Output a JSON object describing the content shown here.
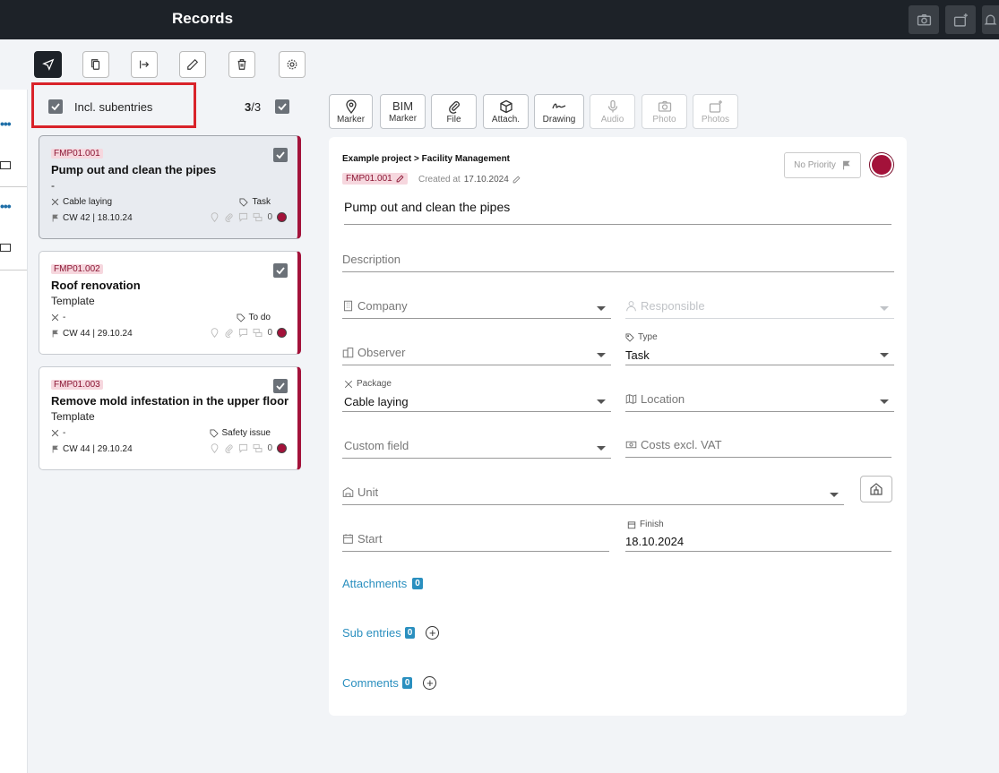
{
  "header": {
    "title": "Records"
  },
  "toolbar": {
    "buttons": [
      "send-icon",
      "copy-icon",
      "move-icon",
      "edit-icon",
      "delete-icon",
      "settings-icon"
    ]
  },
  "list": {
    "incl_subentries_label": "Incl. subentries",
    "count_selected": "3",
    "count_total": "/3",
    "cards": [
      {
        "code": "FMP01.001",
        "title": "Pump out and clean the pipes",
        "subtitle": "-",
        "package": "Cable laying",
        "type": "Task",
        "date": "CW 42 | 18.10.24",
        "comments": "0"
      },
      {
        "code": "FMP01.002",
        "title": "Roof renovation",
        "subtitle": "Template",
        "package": "-",
        "type": "To do",
        "date": "CW 44 | 29.10.24",
        "comments": "0"
      },
      {
        "code": "FMP01.003",
        "title": "Remove mold infestation in the upper floor",
        "subtitle": "Template",
        "package": "-",
        "type": "Safety issue",
        "date": "CW 44 | 29.10.24",
        "comments": "0"
      }
    ]
  },
  "media_toolbar": {
    "marker": "Marker",
    "bim_top": "BIM",
    "bim_bottom": "Marker",
    "file": "File",
    "attach": "Attach.",
    "drawing": "Drawing",
    "audio": "Audio",
    "photo": "Photo",
    "photos": "Photos"
  },
  "detail": {
    "breadcrumb": "Example project > Facility Management",
    "code": "FMP01.001",
    "created_label": "Created at",
    "created_date": "17.10.2024",
    "priority": "No Priority",
    "title": "Pump out and clean the pipes",
    "description_placeholder": "Description",
    "company_placeholder": "Company",
    "responsible_placeholder": "Responsible",
    "observer_placeholder": "Observer",
    "type_label": "Type",
    "type_value": "Task",
    "package_label": "Package",
    "package_value": "Cable laying",
    "location_placeholder": "Location",
    "custom_field_placeholder": "Custom field",
    "costs_placeholder": "Costs excl. VAT",
    "unit_placeholder": "Unit",
    "start_placeholder": "Start",
    "finish_label": "Finish",
    "finish_value": "18.10.2024",
    "attachments_label": "Attachments",
    "attachments_count": "0",
    "subentries_label": "Sub entries",
    "subentries_count": "0",
    "comments_label": "Comments",
    "comments_count": "0"
  },
  "colors": {
    "accent": "#a3123a",
    "link": "#2a8fbf",
    "highlight": "#d9232a",
    "topbar": "#1d2228"
  }
}
